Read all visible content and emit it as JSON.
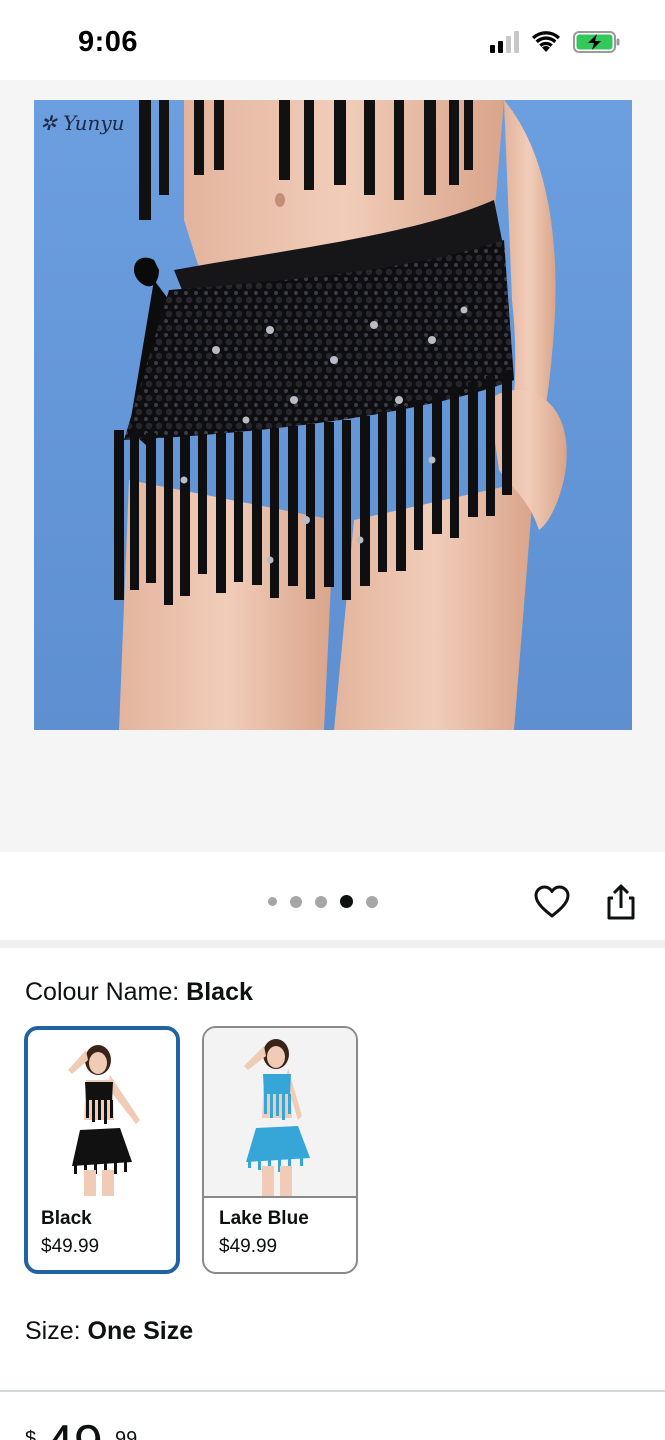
{
  "status_bar": {
    "time": "9:06"
  },
  "gallery": {
    "image_description_icon": "product-photo-black-sequin-skirt",
    "brand_watermark": "Yunyu",
    "pager": {
      "count": 5,
      "active_index": 3
    }
  },
  "actions": {
    "wishlist_icon": "heart-icon",
    "share_icon": "share-icon"
  },
  "variation": {
    "colour_label": "Colour Name: ",
    "colour_value": "Black",
    "options": [
      {
        "name": "Black",
        "price": "$49.99",
        "selected": true,
        "color": "#111111"
      },
      {
        "name": "Lake Blue",
        "price": "$49.99",
        "selected": false,
        "color": "#36a6d8"
      }
    ],
    "size_label": "Size: ",
    "size_value": "One Size"
  },
  "price": {
    "symbol": "$",
    "whole": "49",
    "fraction": "99"
  },
  "colors": {
    "selected_border": "#2162a1",
    "photo_background": "#6a9bdc"
  }
}
